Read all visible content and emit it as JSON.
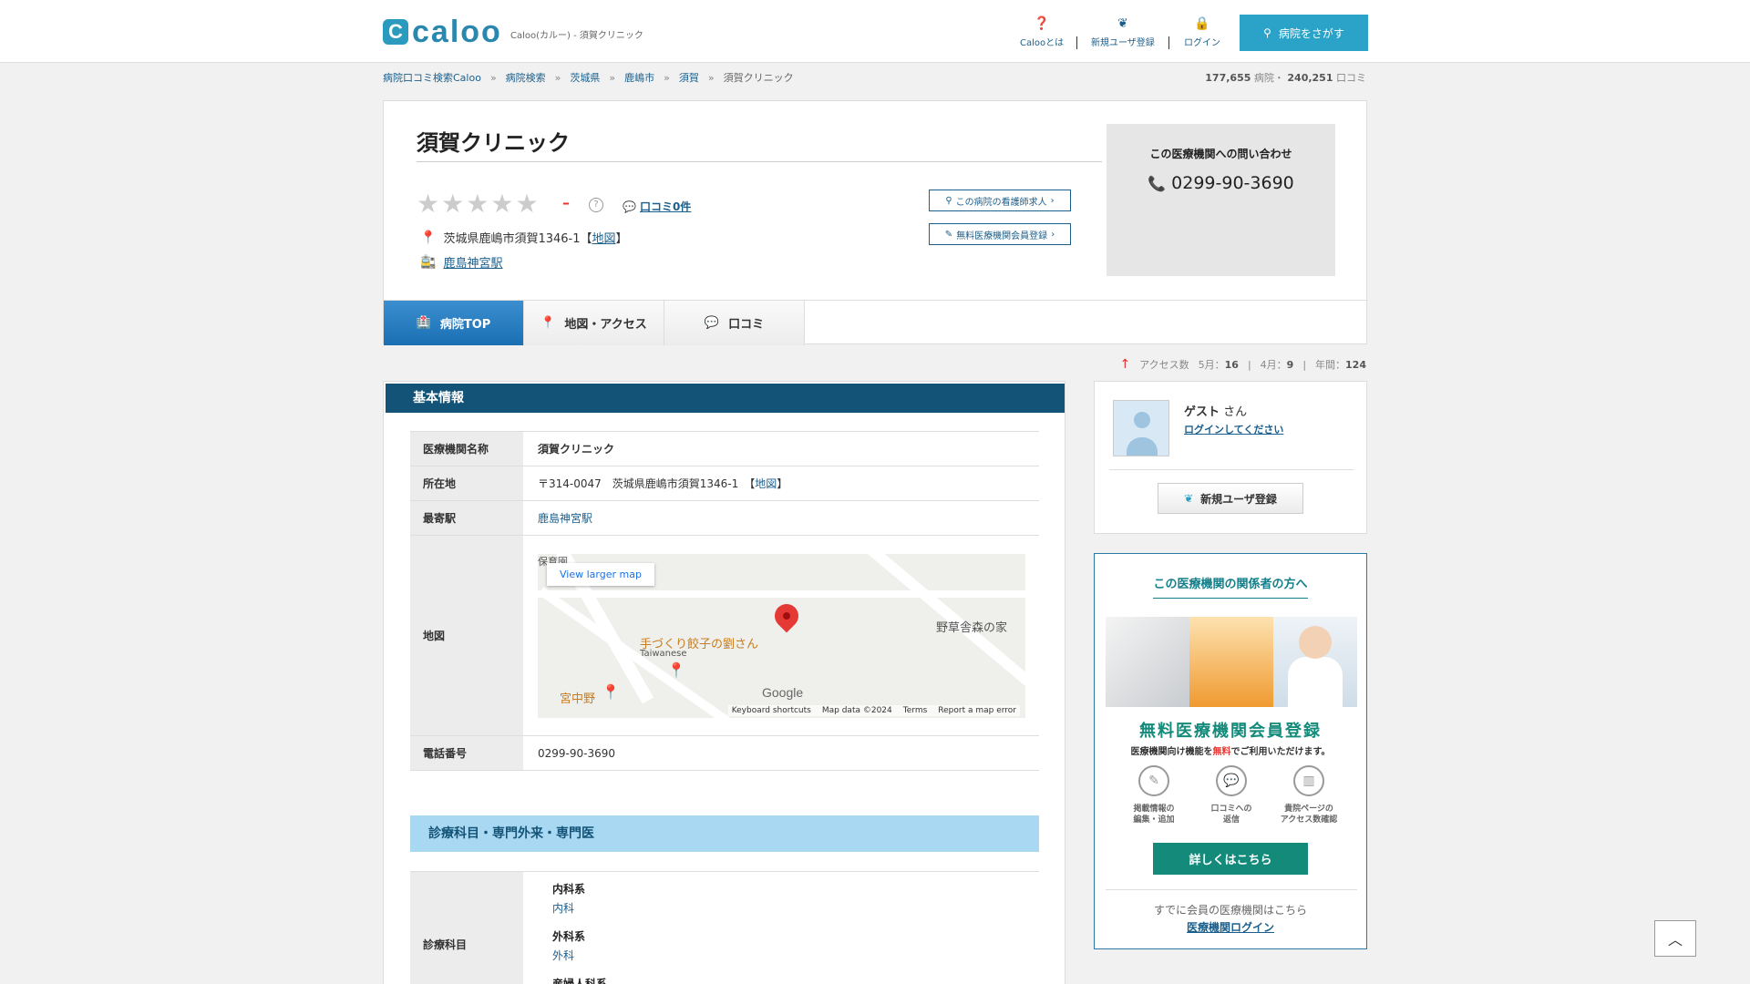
{
  "header": {
    "logo_mark": "C",
    "logo_text": "caloo",
    "logo_sub": "Caloo(カルー) - 須賀クリニック",
    "nav": [
      {
        "label": "Calooとは"
      },
      {
        "label": "新規ユーザ登録"
      },
      {
        "label": "ログイン"
      }
    ],
    "search_label": "病院をさがす"
  },
  "breadcrumb": {
    "items": [
      "病院口コミ検索Caloo",
      "病院検索",
      "茨城県",
      "鹿嶋市",
      "須賀"
    ],
    "current": "須賀クリニック",
    "sep": "»"
  },
  "counts": {
    "hospitals": "177,655",
    "hospitals_unit": "病院・",
    "reviews": "240,251",
    "reviews_unit": "口コミ"
  },
  "clinic": {
    "name": "須賀クリニック",
    "rating_dash": "–",
    "question": "?",
    "review_link": "口コミ0件",
    "address": "茨城県鹿嶋市須賀1346-1",
    "map_link": "地図",
    "bracket_open": "【",
    "bracket_close": "】",
    "station": "鹿島神宮駅",
    "nurse_btn": "この病院の看護師求人",
    "member_btn": "無料医療機関会員登録"
  },
  "contact": {
    "title": "この医療機関への問い合わせ",
    "phone": "0299-90-3690"
  },
  "tabs": [
    {
      "label": "病院TOP"
    },
    {
      "label": "地図・アクセス"
    },
    {
      "label": "口コミ"
    }
  ],
  "access": {
    "label": "アクセス数",
    "may": "5月：",
    "may_val": "16",
    "apr": "4月：",
    "apr_val": "9",
    "year": "年間：",
    "year_val": "124"
  },
  "basic_info": {
    "heading": "基本情報",
    "rows": {
      "name_label": "医療機関名称",
      "name_value": "須賀クリニック",
      "addr_label": "所在地",
      "addr_value": "〒314-0047　茨城県鹿嶋市須賀1346-1　【",
      "addr_map": "地図",
      "addr_close": "】",
      "station_label": "最寄駅",
      "station_value": "鹿島神宮駅",
      "map_label": "地図",
      "phone_label": "電話番号",
      "phone_value": "0299-90-3690"
    },
    "map": {
      "view_larger": "View larger map",
      "place1": "手づくり餃子の劉さん",
      "place1_sub": "Taiwanese",
      "place2": "宮中野",
      "place3": "野草舎森の家",
      "place4": "保育園",
      "google": "Google",
      "attrib": [
        "Keyboard shortcuts",
        "Map data ©2024",
        "Terms",
        "Report a map error"
      ]
    }
  },
  "departments": {
    "heading": "診療科目・専門外来・専門医",
    "row_label": "診療科目",
    "groups": [
      {
        "cat": "内科系",
        "sub": "内科"
      },
      {
        "cat": "外科系",
        "sub": "外科"
      },
      {
        "cat": "産婦人科系",
        "sub": ""
      }
    ]
  },
  "user": {
    "guest": "ゲスト",
    "san": "さん",
    "login_link": "ログインしてください",
    "register": "新規ユーザ登録"
  },
  "relation": {
    "title": "この医療機関の関係者の方へ",
    "big": "無料医療機関会員登録",
    "small_pre": "医療機関向け機能を",
    "small_free": "無料",
    "small_post": "でご利用いただけます。",
    "icons": [
      {
        "l1": "掲載情報の",
        "l2": "編集・追加"
      },
      {
        "l1": "口コミへの",
        "l2": "返信"
      },
      {
        "l1": "貴院ページの",
        "l2": "アクセス数確認"
      }
    ],
    "detail_btn": "詳しくはこちら",
    "already": "すでに会員の医療機関はこちら",
    "login": "医療機関ログイン"
  },
  "colors": {
    "accent": "#2ba3c8",
    "header_band": "#135377",
    "tab_active": "#1a6fb3",
    "relation": "#138a7a"
  }
}
